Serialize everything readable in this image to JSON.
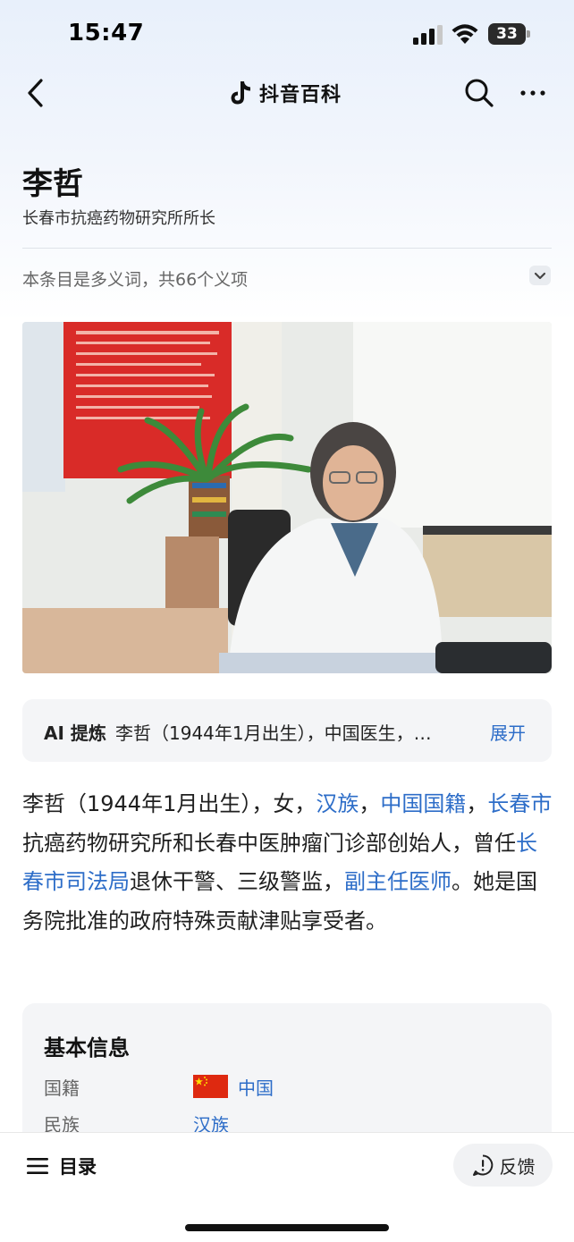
{
  "status_bar": {
    "time": "15:47",
    "battery": "33"
  },
  "nav": {
    "app_name": "抖音百科"
  },
  "header": {
    "title": "李哲",
    "subtitle": "长春市抗癌药物研究所所长",
    "polysemy": "本条目是多义词，共66个义项"
  },
  "ai_summary": {
    "label": "AI 提炼",
    "text": "李哲（1944年1月出生），中国医生，…",
    "expand": "展开"
  },
  "intro": [
    {
      "text": "李哲（1944年1月出生），女，",
      "link": false
    },
    {
      "text": "汉族",
      "link": true
    },
    {
      "text": "，",
      "link": false
    },
    {
      "text": "中国国籍",
      "link": true
    },
    {
      "text": "，",
      "link": false
    },
    {
      "text": "长春市",
      "link": true
    },
    {
      "text": "抗癌药物研究所和长春中医肿瘤门诊部创始人，曾任",
      "link": false
    },
    {
      "text": "长春市司法局",
      "link": true
    },
    {
      "text": "退休干警、三级警监，",
      "link": false
    },
    {
      "text": "副主任医师",
      "link": true
    },
    {
      "text": "。她是国务院批准的政府特殊贡献津贴享受者。",
      "link": false
    }
  ],
  "info": {
    "title": "基本信息",
    "rows": [
      {
        "key": "国籍",
        "value": "中国"
      },
      {
        "key": "民族",
        "value": "汉族"
      }
    ]
  },
  "bottom": {
    "toc": "目录",
    "feedback": "反馈"
  },
  "colors": {
    "link": "#2d6dc8",
    "flag_red": "#de2910",
    "flag_star": "#ffde00"
  }
}
